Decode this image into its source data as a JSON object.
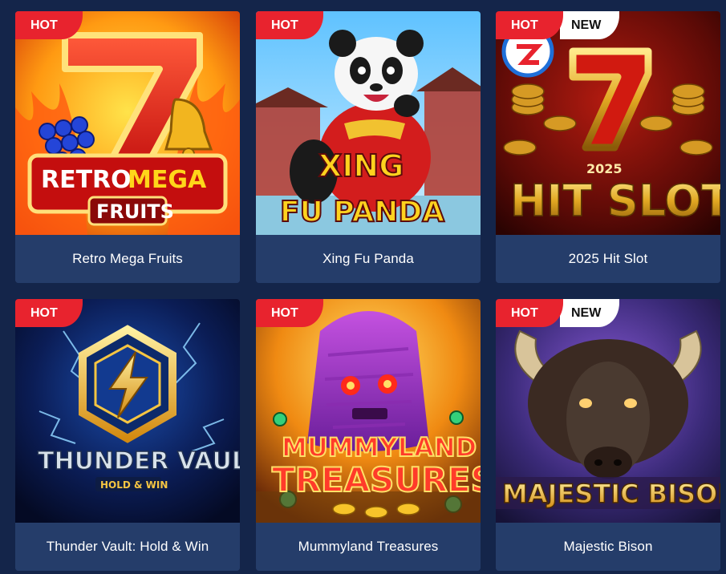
{
  "games": [
    {
      "title": "Retro Mega Fruits",
      "badges": [
        "HOT"
      ],
      "art_text": [
        "RETRO",
        "MEGA",
        "FRUITS"
      ]
    },
    {
      "title": "Xing Fu Panda",
      "badges": [
        "HOT"
      ],
      "art_text": [
        "XING",
        "FU PANDA"
      ]
    },
    {
      "title": "2025 Hit Slot",
      "badges": [
        "HOT",
        "NEW"
      ],
      "art_text": [
        "2025",
        "HIT SLOT"
      ]
    },
    {
      "title": "Thunder Vault: Hold & Win",
      "badges": [
        "HOT"
      ],
      "art_text": [
        "THUNDER VAULT",
        "HOLD & WIN"
      ]
    },
    {
      "title": "Mummyland Treasures",
      "badges": [
        "HOT"
      ],
      "art_text": [
        "MUMMYLAND",
        "TREASURES"
      ]
    },
    {
      "title": "Majestic Bison",
      "badges": [
        "HOT",
        "NEW"
      ],
      "art_text": [
        "MAJESTIC BISON"
      ]
    }
  ],
  "colors": {
    "page_bg": "#14254a",
    "card_label_bg": "#253d6a",
    "hot_badge": "#e8232e",
    "new_badge": "#ffffff"
  }
}
